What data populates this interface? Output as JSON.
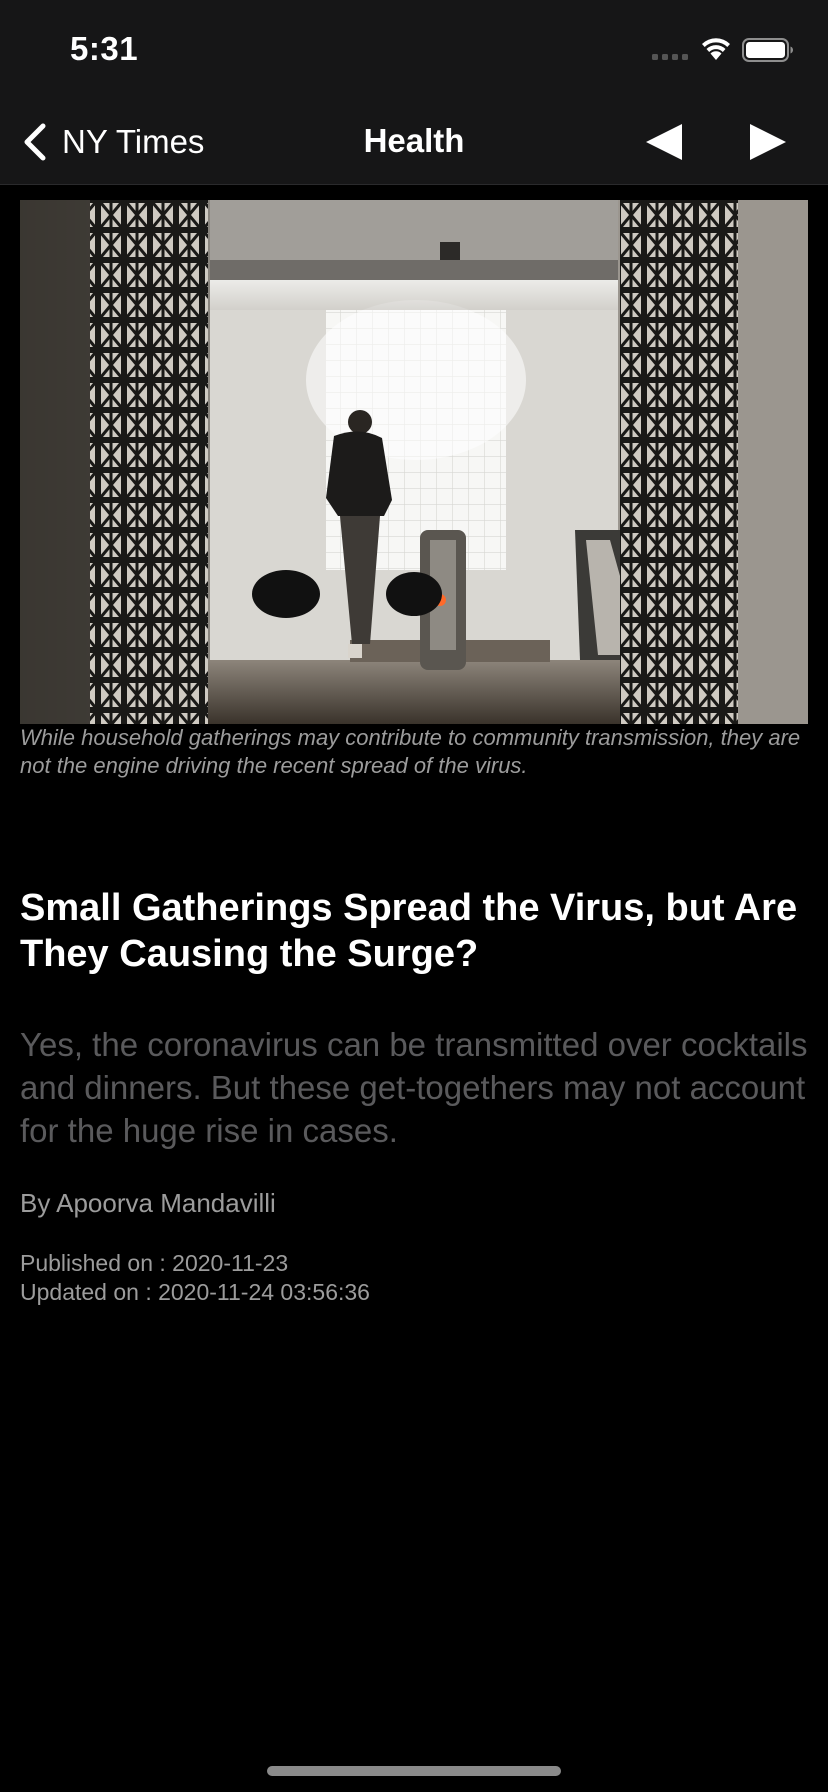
{
  "status_bar": {
    "time": "5:31",
    "icons": [
      "signal-icon",
      "wifi-icon",
      "battery-icon"
    ]
  },
  "nav": {
    "back_label": "NY Times",
    "title": "Health",
    "icons": [
      "chevron-left-icon",
      "triangle-left-icon",
      "triangle-right-icon"
    ]
  },
  "article": {
    "caption": "While household gatherings may contribute to community transmission, they are not the engine driving the recent spread of the virus.",
    "headline": "Small Gatherings Spread the Virus, but Are They Causing the Surge?",
    "summary": "Yes, the coronavirus can be transmitted over cocktails and dinners. But these get-togethers may not account for the huge rise in cases.",
    "byline": "By Apoorva Mandavilli",
    "published": "Published on : 2020-11-23",
    "updated": "Updated on : 2020-11-24 03:56:36"
  },
  "colors": {
    "bar_background": "#161617",
    "page_background": "#000000",
    "secondary_text": "#9c9c9c",
    "summary_text": "#5a5a5c"
  }
}
